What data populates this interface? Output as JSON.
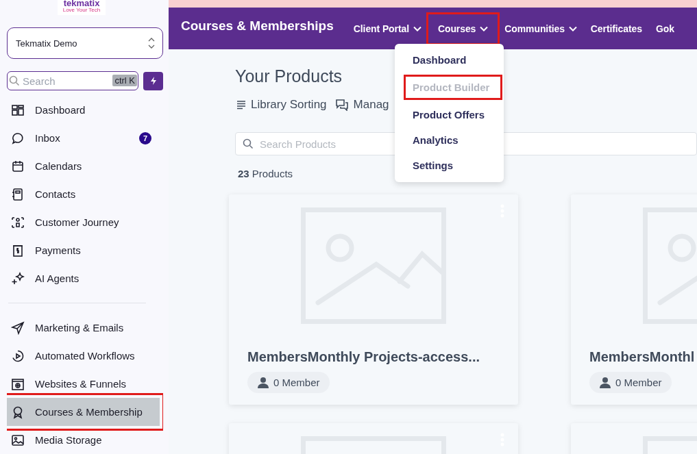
{
  "sidebar": {
    "logo": {
      "name": "tekmatix",
      "tagline": "Love Your Tech"
    },
    "account": "Tekmatix Demo",
    "search": {
      "placeholder": "Search",
      "shortcut": "ctrl K"
    },
    "sections": [
      {
        "items": [
          {
            "label": "Dashboard",
            "selected": false,
            "highlighted": false
          },
          {
            "label": "Inbox",
            "badge": "7",
            "selected": false,
            "highlighted": false
          },
          {
            "label": "Calendars",
            "selected": false,
            "highlighted": false
          },
          {
            "label": "Contacts",
            "selected": false,
            "highlighted": false
          },
          {
            "label": "Customer Journey",
            "selected": false,
            "highlighted": false
          },
          {
            "label": "Payments",
            "selected": false,
            "highlighted": false
          },
          {
            "label": "AI Agents",
            "selected": false,
            "highlighted": false
          }
        ]
      },
      {
        "items": [
          {
            "label": "Marketing & Emails",
            "selected": false,
            "highlighted": false
          },
          {
            "label": "Automated Workflows",
            "selected": false,
            "highlighted": false
          },
          {
            "label": "Websites & Funnels",
            "selected": false,
            "highlighted": false
          },
          {
            "label": "Courses & Membership",
            "selected": true,
            "highlighted": true
          },
          {
            "label": "Media Storage",
            "selected": false,
            "highlighted": false
          }
        ]
      }
    ]
  },
  "topbar": {
    "title": "Courses & Memberships",
    "nav": [
      {
        "label": "Client Portal",
        "dropdown": true,
        "highlighted": false
      },
      {
        "label": "Courses",
        "dropdown": true,
        "highlighted": true,
        "menu": [
          {
            "label": "Dashboard",
            "disabled": false,
            "highlighted": false
          },
          {
            "label": "Product Builder",
            "disabled": true,
            "highlighted": true
          },
          {
            "label": "Product Offers",
            "disabled": false,
            "highlighted": false
          },
          {
            "label": "Analytics",
            "disabled": false,
            "highlighted": false
          },
          {
            "label": "Settings",
            "disabled": false,
            "highlighted": false
          }
        ]
      },
      {
        "label": "Communities",
        "dropdown": true,
        "highlighted": false
      },
      {
        "label": "Certificates",
        "dropdown": false,
        "highlighted": false
      },
      {
        "label": "Gok",
        "dropdown": false,
        "highlighted": false
      }
    ]
  },
  "main": {
    "heading": "Your Products",
    "toolbar": [
      {
        "label": "Library Sorting"
      },
      {
        "label": "Manag"
      }
    ],
    "search": {
      "placeholder": "Search Products"
    },
    "count": "**23** Products",
    "cards": [
      {
        "kind": "product",
        "title": "MembersMonthly Projects-access...",
        "members": "0 Member"
      },
      {
        "kind": "product",
        "title": "MembersMonthl",
        "members": "0 Member"
      },
      {
        "kind": "empty"
      },
      {
        "kind": "empty"
      }
    ]
  }
}
